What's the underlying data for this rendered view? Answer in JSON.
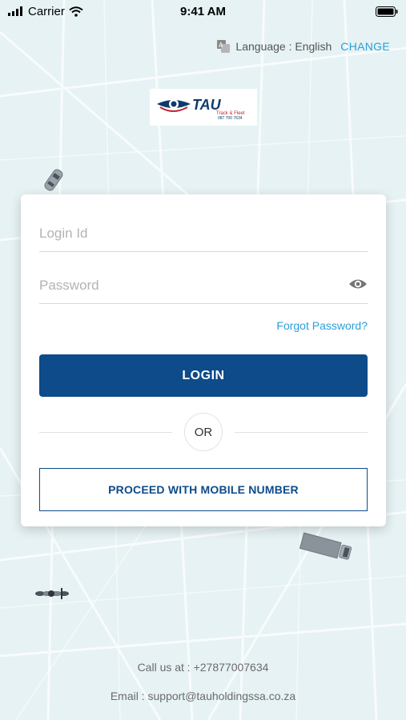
{
  "status_bar": {
    "carrier": "Carrier",
    "time": "9:41 AM",
    "icons": [
      "signal-icon",
      "wifi-icon",
      "battery-icon"
    ]
  },
  "language": {
    "label": "Language : English",
    "change": "CHANGE",
    "icon": "translate-icon"
  },
  "logo": {
    "brand": "TAU",
    "tagline": "Track & Fleet",
    "phone": "087 700 7634"
  },
  "form": {
    "login_id_placeholder": "Login Id",
    "password_placeholder": "Password",
    "forgot_password": "Forgot Password?",
    "login_button": "LOGIN",
    "or_text": "OR",
    "mobile_button": "PROCEED WITH MOBILE NUMBER"
  },
  "footer": {
    "call": "Call us at : +27877007634",
    "email": "Email : support@tauholdingssa.co.za"
  },
  "colors": {
    "primary": "#0d4b8a",
    "link": "#2a9fd8",
    "background": "#e6f2f4"
  }
}
